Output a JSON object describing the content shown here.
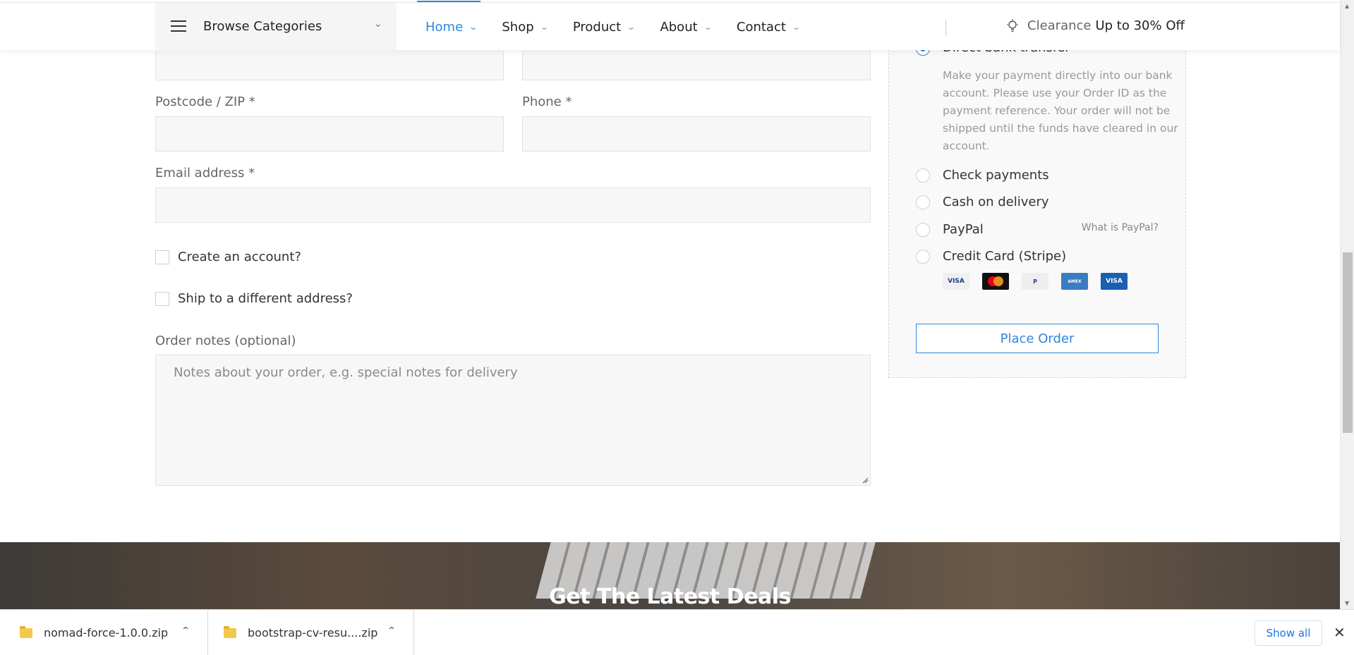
{
  "header": {
    "browse_label": "Browse Categories",
    "nav": [
      {
        "label": "Home"
      },
      {
        "label": "Shop"
      },
      {
        "label": "Product"
      },
      {
        "label": "About"
      },
      {
        "label": "Contact"
      }
    ],
    "clearance_label": "Clearance",
    "clearance_offer": "Up to 30% Off"
  },
  "form": {
    "postcode_label": "Postcode / ZIP *",
    "phone_label": "Phone *",
    "email_label": "Email address *",
    "create_account_label": "Create an account?",
    "ship_different_label": "Ship to a different address?",
    "order_notes_label": "Order notes (optional)",
    "order_notes_placeholder": "Notes about your order, e.g. special notes for delivery"
  },
  "payment": {
    "direct_bank_label": "Direct bank transfer",
    "direct_bank_description": "Make your payment directly into our bank account. Please use your Order ID as the payment reference. Your order will not be shipped until the funds have cleared in our account.",
    "check_label": "Check payments",
    "cod_label": "Cash on delivery",
    "paypal_label": "PayPal",
    "paypal_link": "What is PayPal?",
    "stripe_label": "Credit Card (Stripe)",
    "cards": [
      "VISA",
      "Mastercard",
      "PayPal",
      "American Express",
      "VISA"
    ],
    "place_order_label": "Place Order"
  },
  "banner": {
    "title": "Get The Latest Deals"
  },
  "downloads": {
    "items": [
      {
        "name": "nomad-force-1.0.0.zip"
      },
      {
        "name": "bootstrap-cv-resu....zip"
      }
    ],
    "show_all_label": "Show all"
  },
  "colors": {
    "accent": "#2e86de",
    "input_bg": "#f7f7f7",
    "download_link": "#1a73e8"
  }
}
